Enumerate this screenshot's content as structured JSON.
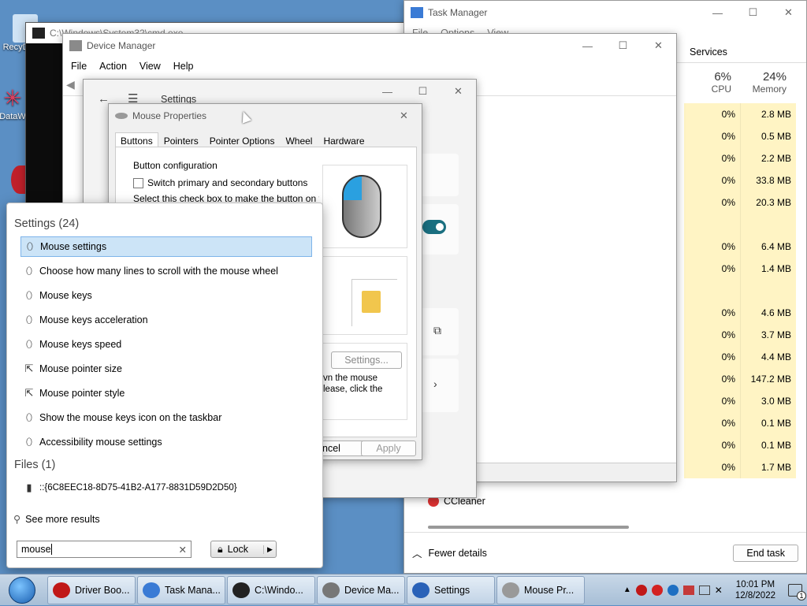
{
  "desktop": {
    "icon1": "RecyDelete",
    "icon2": "DataW"
  },
  "cmd": {
    "title": "C:\\Windows\\System32\\cmd.exe"
  },
  "task_manager": {
    "title": "Task Manager",
    "menu": [
      "File",
      "Options",
      "View"
    ],
    "tab_services": "Services",
    "cpu_pct": "6%",
    "cpu_label": "CPU",
    "mem_pct": "24%",
    "mem_label": "Memory",
    "rows": [
      {
        "cpu": "0%",
        "mem": "2.8 MB"
      },
      {
        "cpu": "0%",
        "mem": "0.5 MB"
      },
      {
        "cpu": "0%",
        "mem": "2.2 MB"
      },
      {
        "cpu": "0%",
        "mem": "33.8 MB"
      },
      {
        "cpu": "0%",
        "mem": "20.3 MB"
      },
      {
        "cpu": "",
        "mem": ""
      },
      {
        "cpu": "0%",
        "mem": "6.4 MB"
      },
      {
        "cpu": "0%",
        "mem": "1.4 MB"
      },
      {
        "cpu": "",
        "mem": ""
      },
      {
        "cpu": "0%",
        "mem": "4.6 MB"
      },
      {
        "cpu": "0%",
        "mem": "3.7 MB"
      },
      {
        "cpu": "0%",
        "mem": "4.4 MB"
      },
      {
        "cpu": "0%",
        "mem": "147.2 MB"
      },
      {
        "cpu": "0%",
        "mem": "3.0 MB"
      },
      {
        "cpu": "0%",
        "mem": "0.1 MB"
      },
      {
        "cpu": "0%",
        "mem": "0.1 MB"
      },
      {
        "cpu": "0%",
        "mem": "1.7 MB"
      }
    ],
    "ccleaner": "CCleaner",
    "fewer_details": "Fewer details",
    "end_task": "End task"
  },
  "device_manager": {
    "title": "Device Manager",
    "menu": [
      "File",
      "Action",
      "View",
      "Help"
    ]
  },
  "settings_window": {
    "title": "Settings"
  },
  "mouse_properties": {
    "title": "Mouse Properties",
    "tabs": [
      "Buttons",
      "Pointers",
      "Pointer Options",
      "Wheel",
      "Hardware"
    ],
    "group_title": "Button configuration",
    "switch_label": "Switch primary and secondary buttons",
    "desc": "Select this check box to make the button on the",
    "settings_btn": "Settings...",
    "text1": "vn the mouse",
    "text2": "lease, click the",
    "cancel": "ncel",
    "apply": "Apply"
  },
  "search_panel": {
    "settings_header": "Settings (24)",
    "results": [
      {
        "label": "Mouse settings",
        "icon": "mouse-icon"
      },
      {
        "label": "Choose how many lines to scroll with the mouse wheel",
        "icon": "mouse-icon"
      },
      {
        "label": "Mouse keys",
        "icon": "mouse-icon"
      },
      {
        "label": "Mouse keys acceleration",
        "icon": "mouse-icon"
      },
      {
        "label": "Mouse keys speed",
        "icon": "mouse-icon"
      },
      {
        "label": "Mouse pointer size",
        "icon": "pointer-icon"
      },
      {
        "label": "Mouse pointer style",
        "icon": "pointer-icon"
      },
      {
        "label": "Show the mouse keys icon on the taskbar",
        "icon": "mouse-icon"
      },
      {
        "label": "Accessibility mouse settings",
        "icon": "mouse-icon"
      }
    ],
    "files_header": "Files (1)",
    "file_result": "::{6C8EEC18-8D75-41B2-A177-8831D59D2D50}",
    "see_more": "See more results",
    "search_value": "mouse",
    "lock_label": "Lock"
  },
  "taskbar": {
    "items": [
      "Driver Boo...",
      "Task Mana...",
      "C:\\Windo...",
      "Device Ma...",
      "Settings",
      "Mouse Pr..."
    ],
    "time": "10:01 PM",
    "date": "12/8/2022",
    "notif_count": "1"
  },
  "colors": {
    "selection": "#cce4f7",
    "tm_highlight": "#fff4c4",
    "toggle": "#1a6f80"
  }
}
